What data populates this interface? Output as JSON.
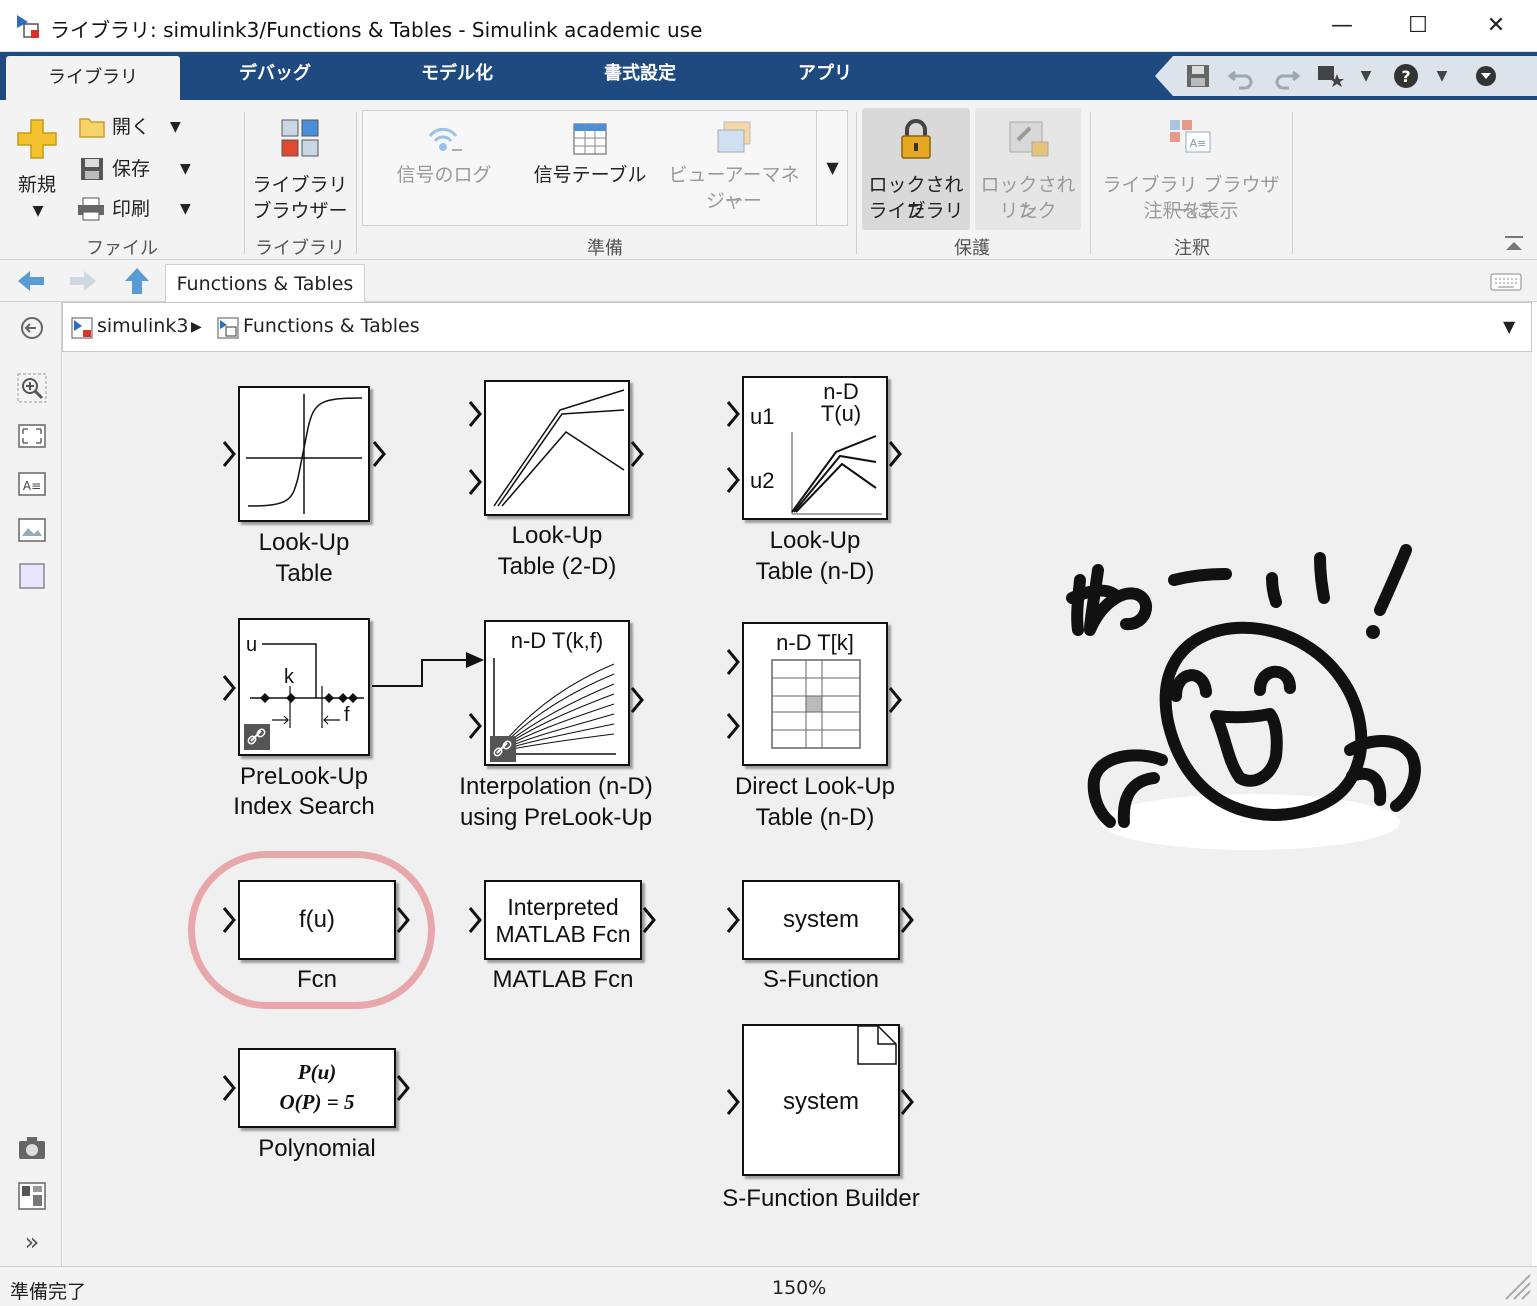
{
  "window": {
    "title": "ライブラリ: simulink3/Functions & Tables - Simulink academic use",
    "minimize": "—",
    "maximize": "☐",
    "close": "✕"
  },
  "tabs": [
    {
      "label": "ライブラリ",
      "active": true
    },
    {
      "label": "デバッグ"
    },
    {
      "label": "モデル化"
    },
    {
      "label": "書式設定"
    },
    {
      "label": "アプリ"
    }
  ],
  "ribbon": {
    "file": {
      "new_label": "新規",
      "open_label": "開く",
      "save_label": "保存",
      "print_label": "印刷",
      "group_label": "ファイル"
    },
    "library": {
      "browser_label_1": "ライブラリ",
      "browser_label_2": "ブラウザー",
      "group_label": "ライブラリ"
    },
    "prepare": {
      "signal_log": "信号のログ",
      "signal_table": "信号テーブル",
      "viewer_manager_1": "ビューアーマネー",
      "viewer_manager_2": "ジャー",
      "group_label": "準備"
    },
    "protect": {
      "locked_library_1": "ロックされた",
      "locked_library_2": "ライブラリ",
      "locked_link_1": "ロックされた",
      "locked_link_2": "リンク",
      "group_label": "保護"
    },
    "annotate": {
      "show_notes_1": "ライブラリ ブラウザーに",
      "show_notes_2": "注釈を表示",
      "group_label": "注釈"
    }
  },
  "nav": {
    "tab_label": "Functions & Tables"
  },
  "breadcrumb": {
    "root": "simulink3",
    "current": "Functions & Tables"
  },
  "blocks": {
    "lut1d": {
      "label_1": "Look-Up",
      "label_2": "Table"
    },
    "lut2d": {
      "label_1": "Look-Up",
      "label_2": "Table (2-D)"
    },
    "lutnd": {
      "label_1": "Look-Up",
      "label_2": "Table (n-D)",
      "in1": "u1",
      "in2": "u2",
      "title_1": "n-D",
      "title_2": "T(u)"
    },
    "prelookup": {
      "label_1": "PreLook-Up",
      "label_2": "Index Search",
      "u": "u",
      "k": "k",
      "f": "f"
    },
    "interp": {
      "label_1": "Interpolation (n-D)",
      "label_2": "using PreLook-Up",
      "title": "n-D T(k,f)"
    },
    "direct": {
      "label_1": "Direct Look-Up",
      "label_2": "Table (n-D)",
      "title": "n-D T[k]"
    },
    "fcn": {
      "label": "Fcn",
      "text": "f(u)"
    },
    "matlabfcn": {
      "label": "MATLAB Fcn",
      "text_1": "Interpreted",
      "text_2": "MATLAB Fcn"
    },
    "sfunction": {
      "label": "S-Function",
      "text": "system"
    },
    "polynomial": {
      "label": "Polynomial",
      "text_1": "P(u)",
      "text_2": "O(P) = 5"
    },
    "sfunbuilder": {
      "label": "S-Function Builder",
      "text": "system"
    }
  },
  "status": {
    "left": "準備完了",
    "zoom": "150%"
  },
  "colors": {
    "tab_bar": "#1f4a80",
    "highlight": "#e8a7aa"
  }
}
